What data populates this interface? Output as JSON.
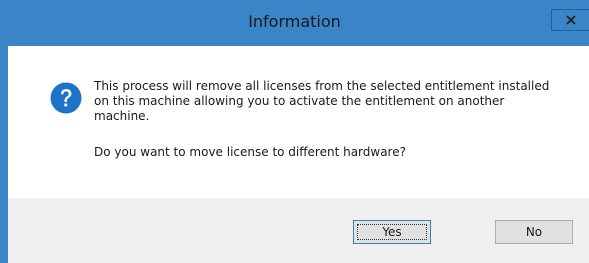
{
  "dialog": {
    "title": "Information",
    "close_glyph": "x",
    "icon": "question-icon",
    "message": "This process will remove all licenses from the selected entitlement installed on this machine allowing you to activate the entitlement on another machine.",
    "question": "Do you want to move license to different hardware?",
    "buttons": {
      "yes": "Yes",
      "no": "No"
    }
  },
  "colors": {
    "titlebar": "#3a84c8",
    "icon_blue": "#1e73c8",
    "footer": "#f0f0f0",
    "button": "#e1e1e1"
  }
}
